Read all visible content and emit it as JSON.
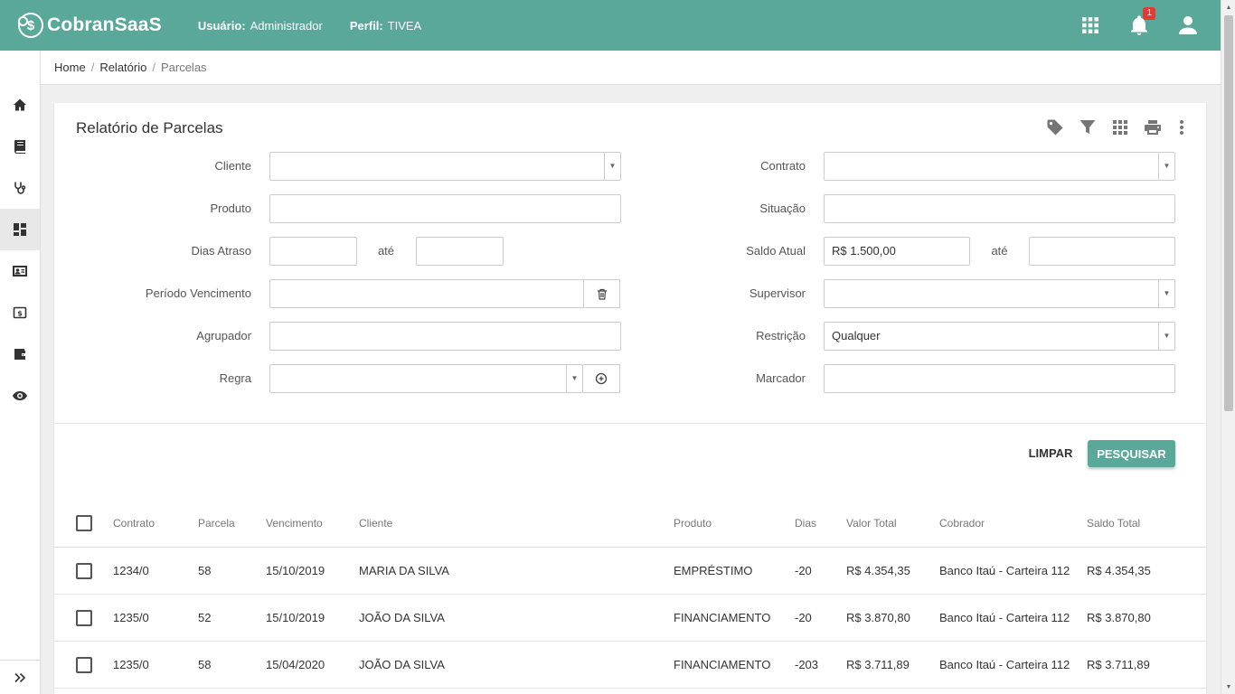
{
  "app": {
    "name": "CobranSaaS",
    "logo_glyph": "$"
  },
  "header": {
    "user_label": "Usuário:",
    "user_value": "Administrador",
    "profile_label": "Perfil:",
    "profile_value": "TIVEA",
    "notifications_count": "1",
    "icons": [
      "apps-grid-icon",
      "bell-icon",
      "account-icon"
    ]
  },
  "sidebar": {
    "items": [
      {
        "icon": "home-icon",
        "active": false
      },
      {
        "icon": "book-icon",
        "active": false
      },
      {
        "icon": "stethoscope-icon",
        "active": false
      },
      {
        "icon": "dashboard-icon",
        "active": true
      },
      {
        "icon": "contact-card-icon",
        "active": false
      },
      {
        "icon": "money-icon",
        "active": false
      },
      {
        "icon": "wallet-icon",
        "active": false
      },
      {
        "icon": "eye-icon",
        "active": false
      }
    ],
    "expand_icon": "double-chevron-right-icon"
  },
  "breadcrumb": {
    "items": [
      "Home",
      "Relatório"
    ],
    "current": "Parcelas"
  },
  "report": {
    "title": "Relatório de Parcelas",
    "tools": [
      "tag-icon",
      "filter-icon",
      "grid-icon",
      "print-icon",
      "more-vert-icon"
    ]
  },
  "filters": {
    "cliente": {
      "label": "Cliente",
      "value": ""
    },
    "produto": {
      "label": "Produto",
      "value": ""
    },
    "dias_atraso": {
      "label": "Dias Atraso",
      "from": "",
      "to_label": "até",
      "to": ""
    },
    "periodo_vencimento": {
      "label": "Período Vencimento",
      "value": ""
    },
    "agrupador": {
      "label": "Agrupador",
      "value": ""
    },
    "regra": {
      "label": "Regra",
      "value": ""
    },
    "contrato": {
      "label": "Contrato",
      "value": ""
    },
    "situacao": {
      "label": "Situação",
      "value": ""
    },
    "saldo_atual": {
      "label": "Saldo Atual",
      "from": "R$ 1.500,00",
      "to_label": "até",
      "to": ""
    },
    "supervisor": {
      "label": "Supervisor",
      "value": ""
    },
    "restricao": {
      "label": "Restrição",
      "value": "Qualquer"
    },
    "marcador": {
      "label": "Marcador",
      "value": ""
    }
  },
  "actions": {
    "clear_label": "LIMPAR",
    "search_label": "PESQUISAR",
    "accent": "#5aa899"
  },
  "table": {
    "columns": [
      "Contrato",
      "Parcela",
      "Vencimento",
      "Cliente",
      "Produto",
      "Dias",
      "Valor Total",
      "Cobrador",
      "Saldo Total"
    ],
    "rows": [
      {
        "contrato": "1234/0",
        "parcela": "58",
        "vencimento": "15/10/2019",
        "cliente": "MARIA DA SILVA",
        "produto": "EMPRÉSTIMO",
        "dias": "-20",
        "valor_total": "R$ 4.354,35",
        "cobrador": "Banco Itaú - Carteira 112",
        "saldo_total": "R$ 4.354,35"
      },
      {
        "contrato": "1235/0",
        "parcela": "52",
        "vencimento": "15/10/2019",
        "cliente": "JOÃO DA SILVA",
        "produto": "FINANCIAMENTO",
        "dias": "-20",
        "valor_total": "R$ 3.870,80",
        "cobrador": "Banco Itaú - Carteira 112",
        "saldo_total": "R$ 3.870,80"
      },
      {
        "contrato": "1235/0",
        "parcela": "58",
        "vencimento": "15/04/2020",
        "cliente": "JOÃO DA SILVA",
        "produto": "FINANCIAMENTO",
        "dias": "-203",
        "valor_total": "R$ 3.711,89",
        "cobrador": "Banco Itaú - Carteira 112",
        "saldo_total": "R$ 3.711,89"
      }
    ]
  }
}
